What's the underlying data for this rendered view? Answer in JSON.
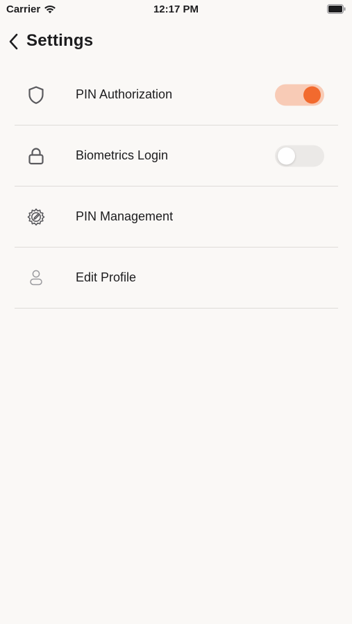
{
  "status_bar": {
    "carrier": "Carrier",
    "time": "12:17 PM"
  },
  "header": {
    "title": "Settings"
  },
  "settings": {
    "items": [
      {
        "label": "PIN Authorization",
        "icon": "shield-icon",
        "toggle": true,
        "enabled": true
      },
      {
        "label": "Biometrics Login",
        "icon": "lock-icon",
        "toggle": true,
        "enabled": false
      },
      {
        "label": "PIN Management",
        "icon": "gear-edit-icon",
        "toggle": false
      },
      {
        "label": "Edit Profile",
        "icon": "person-icon",
        "toggle": false
      }
    ]
  },
  "colors": {
    "accent": "#f26a2e",
    "toggle_on_track": "#f8cbb6",
    "toggle_off_track": "#ebe9e7",
    "background": "#faf8f6"
  }
}
